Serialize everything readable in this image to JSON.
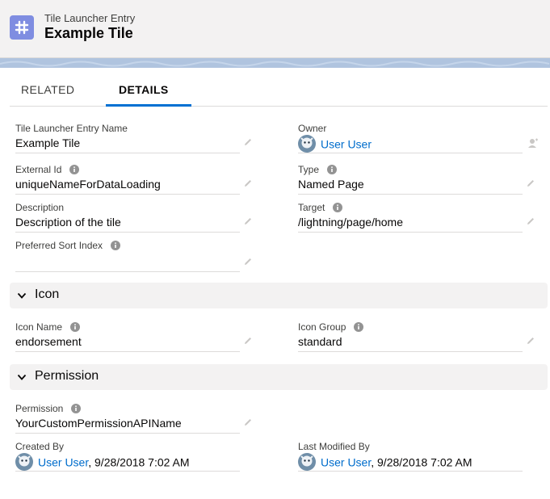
{
  "header": {
    "object_label": "Tile Launcher Entry",
    "record_name": "Example Tile",
    "icon": "tile-launcher-icon",
    "icon_color": "#7f8de1"
  },
  "tabs": [
    {
      "label": "RELATED",
      "active": false
    },
    {
      "label": "DETAILS",
      "active": true
    }
  ],
  "colors": {
    "accent": "#0070d2",
    "link": "#006dcc",
    "section_bg": "#f3f2f2"
  },
  "fields": {
    "name": {
      "label": "Tile Launcher Entry Name",
      "value": "Example Tile"
    },
    "owner": {
      "label": "Owner",
      "value": "User User"
    },
    "external_id": {
      "label": "External Id",
      "value": "uniqueNameForDataLoading"
    },
    "type": {
      "label": "Type",
      "value": "Named Page"
    },
    "description": {
      "label": "Description",
      "value": "Description of the tile"
    },
    "target": {
      "label": "Target",
      "value": "/lightning/page/home"
    },
    "sort_index": {
      "label": "Preferred Sort Index",
      "value": ""
    },
    "icon_name": {
      "label": "Icon Name",
      "value": "endorsement"
    },
    "icon_group": {
      "label": "Icon Group",
      "value": "standard"
    },
    "permission": {
      "label": "Permission",
      "value": "YourCustomPermissionAPIName"
    },
    "created_by": {
      "label": "Created By",
      "user": "User User",
      "date": ", 9/28/2018 7:02 AM"
    },
    "last_modified_by": {
      "label": "Last Modified By",
      "user": "User User",
      "date": ", 9/28/2018 7:02 AM"
    }
  },
  "sections": {
    "icon": {
      "title": "Icon",
      "expanded": true
    },
    "permission": {
      "title": "Permission",
      "expanded": true
    }
  }
}
